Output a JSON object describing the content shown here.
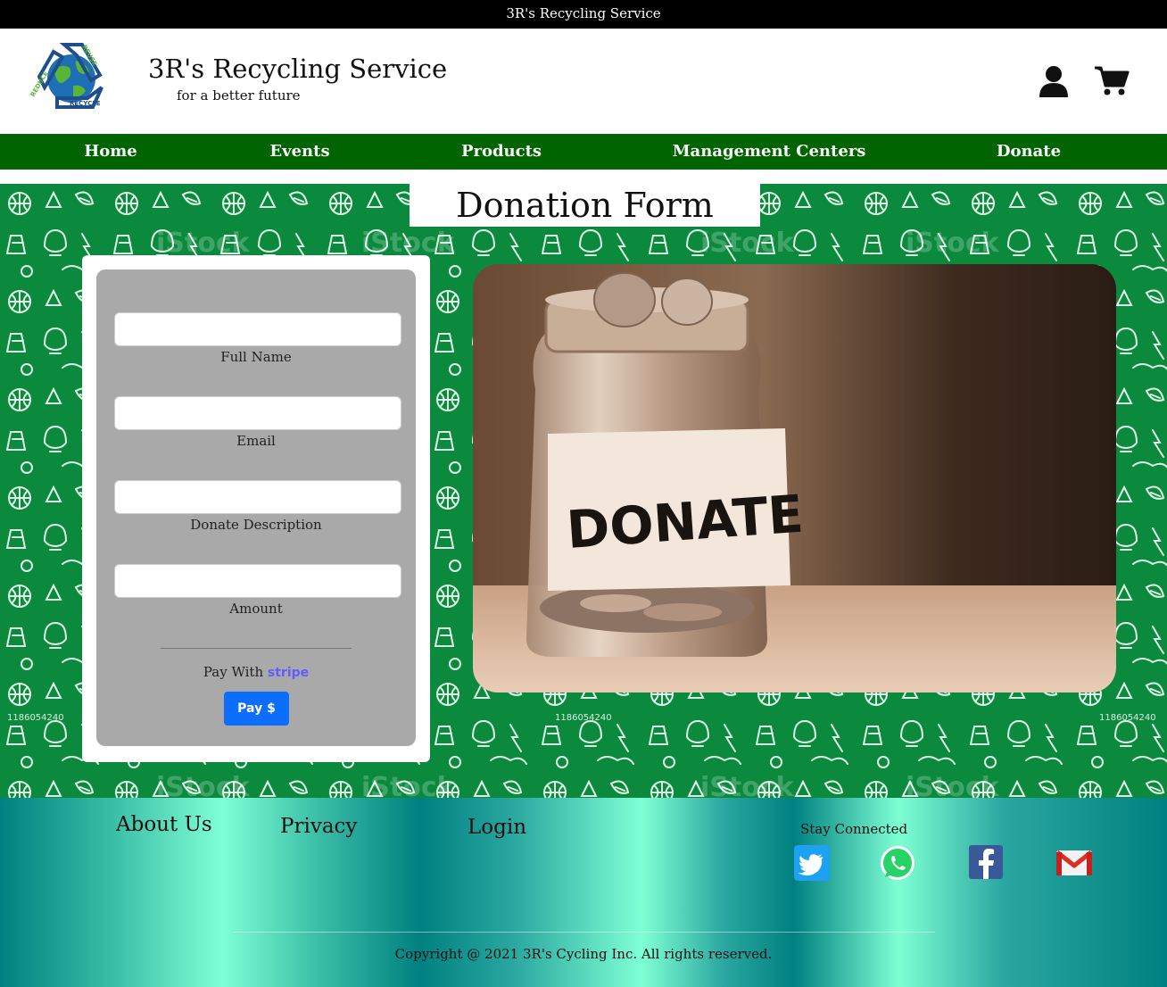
{
  "topbar": {
    "title": "3R's Recycling Service"
  },
  "header": {
    "brand_title": "3R's Recycling Service",
    "tagline": "for a better future",
    "logo": {
      "words": [
        "REDUCE",
        "REUSE",
        "RECYCLE"
      ]
    },
    "icons": [
      "user-icon",
      "cart-icon"
    ]
  },
  "nav": {
    "items": [
      {
        "label": "Home"
      },
      {
        "label": "Events"
      },
      {
        "label": "Products"
      },
      {
        "label": "Management Centers"
      },
      {
        "label": "Donate"
      }
    ]
  },
  "hero": {
    "title": "Donation Form",
    "watermark": "iStock",
    "watermark_id": "1186054240",
    "photo_label": "DONATE"
  },
  "form": {
    "fields": [
      {
        "label": "Full Name",
        "value": "",
        "placeholder": ""
      },
      {
        "label": "Email",
        "value": "",
        "placeholder": ""
      },
      {
        "label": "Donate Description",
        "value": "",
        "placeholder": ""
      },
      {
        "label": "Amount",
        "value": "",
        "placeholder": ""
      }
    ],
    "pay_with": "Pay With",
    "pay_provider": "stripe",
    "pay_button": "Pay $"
  },
  "footer": {
    "links": [
      {
        "label": "About Us"
      },
      {
        "label": "Privacy"
      },
      {
        "label": "Login"
      }
    ],
    "stay_connected": "Stay Connected",
    "social": [
      "twitter-icon",
      "whatsapp-icon",
      "facebook-icon",
      "gmail-icon"
    ],
    "copyright": "Copyright @ 2021 3R's Cycling Inc. All rights reserved."
  },
  "colors": {
    "nav_green": "#006400",
    "hero_green": "#0b8a3e",
    "form_gray": "#a9a9a9",
    "pay_blue": "#0d6efd",
    "stripe_purple": "#635bff",
    "footer_teal": "#008080",
    "footer_aqua": "#7fffd4"
  }
}
